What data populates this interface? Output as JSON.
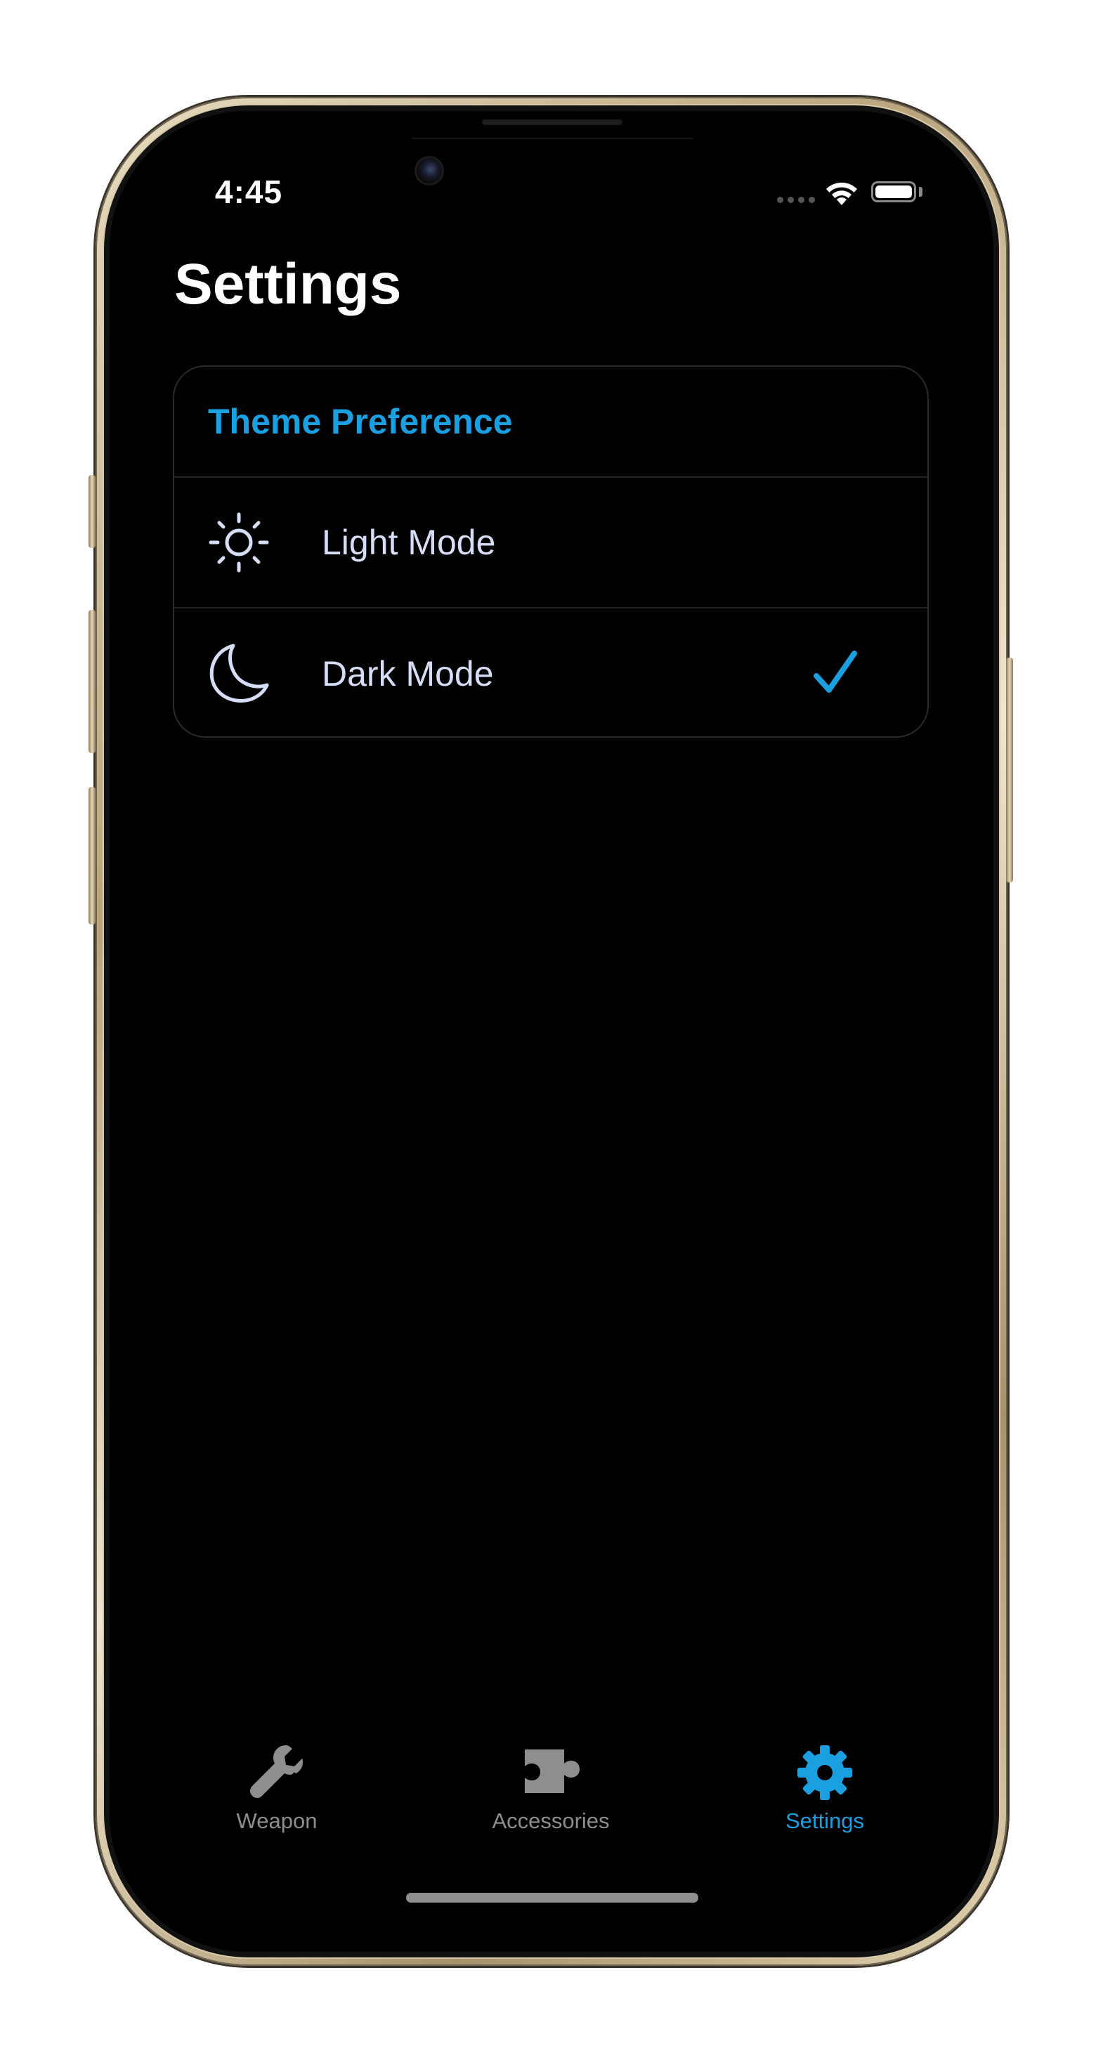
{
  "status_bar": {
    "time": "4:45"
  },
  "settings": {
    "title": "Settings",
    "section_header": "Theme Preference",
    "options": [
      {
        "label": "Light Mode",
        "icon": "sun-icon",
        "selected": false
      },
      {
        "label": "Dark Mode",
        "icon": "moon-icon",
        "selected": true
      }
    ]
  },
  "tab_bar": {
    "tabs": [
      {
        "label": "Weapon",
        "icon": "wrench-icon",
        "active": false
      },
      {
        "label": "Accessories",
        "icon": "puzzle-icon",
        "active": false
      },
      {
        "label": "Settings",
        "icon": "gear-icon",
        "active": true
      }
    ]
  },
  "colors": {
    "accent": "#1a9fe0",
    "option_text": "#d6ddf7",
    "inactive_tab": "#8e8e8e",
    "background": "#000000"
  }
}
